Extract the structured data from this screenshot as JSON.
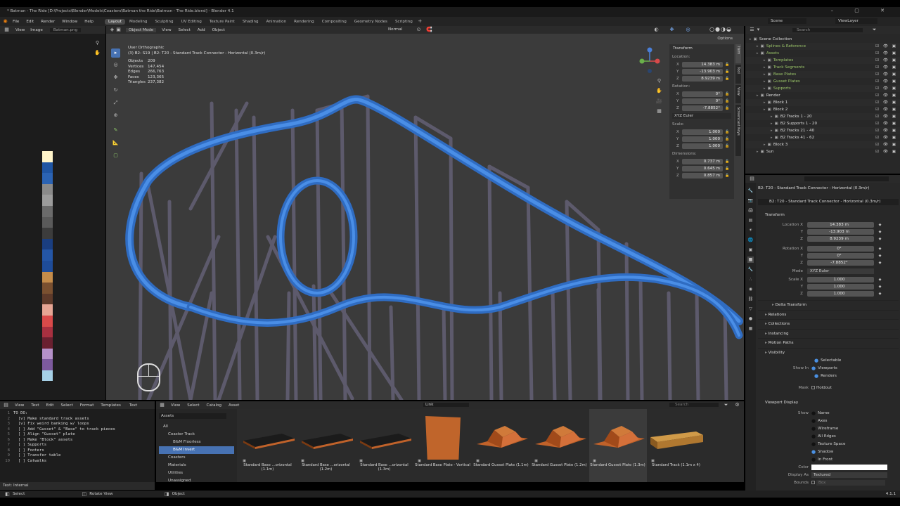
{
  "window": {
    "title": "* Batman - The Ride [D:\\Projects\\Blender\\Models\\Coasters\\Batman the Ride\\Batman - The Ride.blend] - Blender 4.1"
  },
  "menu": [
    "File",
    "Edit",
    "Render",
    "Window",
    "Help"
  ],
  "workspaces": [
    "Layout",
    "Modeling",
    "Sculpting",
    "UV Editing",
    "Texture Paint",
    "Shading",
    "Animation",
    "Rendering",
    "Compositing",
    "Geometry Nodes",
    "Scripting"
  ],
  "active_workspace": "Layout",
  "scene": "Scene",
  "viewlayer": "ViewLayer",
  "image_editor": {
    "view": "View",
    "image": "Image",
    "file": "Batman.png"
  },
  "palette": [
    "#fff4c9",
    "#1f55a3",
    "#2b63b3",
    "#8a8a8a",
    "#9c9c9c",
    "#6b6b6b",
    "#5a5a5a",
    "#3c3c3c",
    "#1a3e80",
    "#2456a6",
    "#1e4c99",
    "#c48c4a",
    "#7a5030",
    "#5e3a2a",
    "#e6a594",
    "#d94a4a",
    "#a83040",
    "#6a2030",
    "#b591c9",
    "#7d5a9e",
    "#a6d0e6"
  ],
  "viewport": {
    "mode": "Object Mode",
    "menus": [
      "View",
      "Select",
      "Add",
      "Object"
    ],
    "shading": "Normal",
    "options": "Options",
    "view_name": "User Orthographic",
    "active": "(3) B2: S19 | B2: T20 - Standard Track Connector - Horizontal (0.3m/r)",
    "stats": [
      {
        "k": "Objects",
        "v": "209"
      },
      {
        "k": "Vertices",
        "v": "147,454"
      },
      {
        "k": "Edges",
        "v": "266,763"
      },
      {
        "k": "Faces",
        "v": "123,365"
      },
      {
        "k": "Triangles",
        "v": "237,382"
      }
    ],
    "npanel": {
      "title": "Transform",
      "location_label": "Location:",
      "rotation_label": "Rotation:",
      "scale_label": "Scale:",
      "dimensions_label": "Dimensions:",
      "location": [
        {
          "a": "X",
          "v": "14.383 m"
        },
        {
          "a": "Y",
          "v": "-13.903 m"
        },
        {
          "a": "Z",
          "v": "8.9239 m"
        }
      ],
      "rotation": [
        {
          "a": "X",
          "v": "0°"
        },
        {
          "a": "Y",
          "v": "0°"
        },
        {
          "a": "Z",
          "v": "-7.8852°"
        }
      ],
      "rotation_mode": "XYZ Euler",
      "scale": [
        {
          "a": "X",
          "v": "1.000"
        },
        {
          "a": "Y",
          "v": "1.000"
        },
        {
          "a": "Z",
          "v": "1.000"
        }
      ],
      "dimensions": [
        {
          "a": "X",
          "v": "0.737 m"
        },
        {
          "a": "Y",
          "v": "0.645 m"
        },
        {
          "a": "Z",
          "v": "0.857 m"
        }
      ],
      "tabs": [
        "Item",
        "Tool",
        "View",
        "Screencast Keys"
      ]
    }
  },
  "outliner": {
    "search_placeholder": "Search",
    "items": [
      {
        "label": "Scene Collection",
        "indent": 0,
        "color": "#ddd"
      },
      {
        "label": "Splines & Reference",
        "indent": 1,
        "color": "#9ac468"
      },
      {
        "label": "Assets",
        "indent": 1,
        "color": "#9ac468"
      },
      {
        "label": "Templates",
        "indent": 2,
        "color": "#9ac468"
      },
      {
        "label": "Track Segments",
        "indent": 2,
        "color": "#9ac468"
      },
      {
        "label": "Base Plates",
        "indent": 2,
        "color": "#9ac468"
      },
      {
        "label": "Gusset Plates",
        "indent": 2,
        "color": "#9ac468"
      },
      {
        "label": "Supports",
        "indent": 2,
        "color": "#9ac468"
      },
      {
        "label": "Render",
        "indent": 1,
        "color": "#ddd"
      },
      {
        "label": "Block 1",
        "indent": 2,
        "color": "#ddd"
      },
      {
        "label": "Block 2",
        "indent": 2,
        "color": "#ddd"
      },
      {
        "label": "B2 Tracks 1 - 20",
        "indent": 3,
        "color": "#ddd"
      },
      {
        "label": "B2 Supports 1 - 20",
        "indent": 3,
        "color": "#ddd"
      },
      {
        "label": "B2 Tracks 21 - 40",
        "indent": 3,
        "color": "#ddd"
      },
      {
        "label": "B2 Tracks 41 - 62",
        "indent": 3,
        "color": "#ddd"
      },
      {
        "label": "Block 3",
        "indent": 2,
        "color": "#ddd"
      },
      {
        "label": "Sun",
        "indent": 1,
        "color": "#ddd"
      }
    ]
  },
  "properties": {
    "breadcrumb": "B2: T20 - Standard Track Connector - Horizontal (0.3m/r)",
    "object_name": "B2: T20 - Standard Track Connector - Horizontal (0.3m/r)",
    "transform": "Transform",
    "location_label": "Location X",
    "rotation_label": "Rotation X",
    "mode_label": "Mode",
    "scale_label": "Scale X",
    "location": [
      "14.383 m",
      "-13.903 m",
      "8.9239 m"
    ],
    "rotation": [
      "0°",
      "0°",
      "-7.8852°"
    ],
    "mode": "XYZ Euler",
    "scale": [
      "1.000",
      "1.000",
      "1.000"
    ],
    "sections": [
      "Delta Transform",
      "Relations",
      "Collections",
      "Instancing",
      "Motion Paths",
      "Visibility"
    ],
    "visibility": {
      "selectable": "Selectable",
      "show_in": "Show In",
      "viewports": "Viewports",
      "renders": "Renders",
      "mask": "Mask",
      "holdout": "Holdout"
    },
    "viewport_display": "Viewport Display",
    "vd": {
      "show": "Show",
      "name": "Name",
      "axes": "Axes",
      "wireframe": "Wireframe",
      "all_edges": "All Edges",
      "texture_space": "Texture Space",
      "shadow": "Shadow",
      "in_front": "In Front",
      "color": "Color",
      "display_as": "Display As",
      "display_value": "Textured",
      "bounds": "Bounds",
      "bounds_value": "Box"
    }
  },
  "text_editor": {
    "menus": [
      "View",
      "Text",
      "Edit",
      "Select",
      "Format",
      "Templates"
    ],
    "name": "Text",
    "lines": [
      "TO DO:",
      "  [v] Make standard track assets",
      "  [v] Fix weird banking w/ loops",
      "  [ ] Add \"Gusset\" & \"Base\" to track pieces",
      "  [ ] Align \"Gusset\" plate",
      "  [ ] Make \"Block\" assets",
      "  [ ] Supports",
      "  [ ] Footers",
      "  [ ] Transfer table",
      "  [ ] Catwalks"
    ],
    "footer": "Text: Internal"
  },
  "asset_browser": {
    "menus": [
      "View",
      "Select",
      "Catalog",
      "Asset"
    ],
    "library": "Assets",
    "import": "Link",
    "search_placeholder": "Search",
    "tree": [
      {
        "label": "All",
        "indent": 0
      },
      {
        "label": "Coaster Track",
        "indent": 1
      },
      {
        "label": "B&M Floorless",
        "indent": 2
      },
      {
        "label": "B&M Invert",
        "indent": 2,
        "active": true
      },
      {
        "label": "Coasters",
        "indent": 1
      },
      {
        "label": "Materials",
        "indent": 1
      },
      {
        "label": "Utilities",
        "indent": 1
      },
      {
        "label": "Unassigned",
        "indent": 1
      }
    ],
    "items": [
      "Standard Base ...orizontal (1.1m)",
      "Standard Base ...orizontal (1.2m)",
      "Standard Base ...orizontal (1.3m)",
      "Standard Base Plate - Vertical",
      "Standard Gusset Plate (1.1m)",
      "Standard Gusset Plate (1.2m)",
      "Standard Gusset Plate (1.3m)",
      "Standard Track (1.1m x 4)"
    ]
  },
  "statusbar": {
    "select": "Select",
    "rotate": "Rotate View",
    "object": "Object",
    "version": "4.1.1"
  }
}
